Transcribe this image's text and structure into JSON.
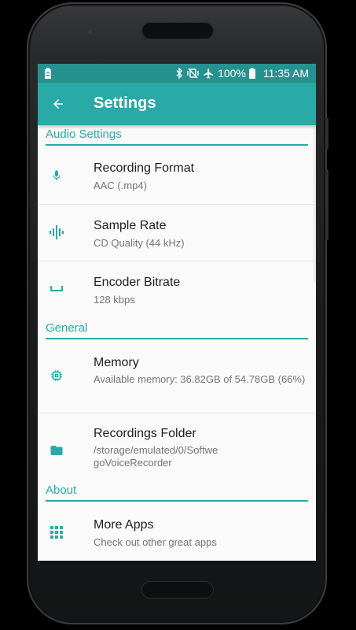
{
  "status_bar": {
    "battery_percent": "100%",
    "time": "11:35 AM",
    "icons": [
      "bluetooth-icon",
      "vibrate-off-icon",
      "airplane-icon",
      "battery-full-icon"
    ]
  },
  "app_bar": {
    "title": "Settings",
    "back_icon": "arrow-back-icon"
  },
  "colors": {
    "accent": "#2aaaa6",
    "status_bar": "#26928f",
    "title_text": "#212121",
    "summary_text": "#757575"
  },
  "sections": [
    {
      "header": "Audio Settings",
      "items": [
        {
          "icon": "microphone-icon",
          "title": "Recording Format",
          "summary": "AAC (.mp4)"
        },
        {
          "icon": "waveform-icon",
          "title": "Sample Rate",
          "summary": "CD Quality (44 kHz)"
        },
        {
          "icon": "space-bar-icon",
          "title": "Encoder Bitrate",
          "summary": "128 kbps"
        }
      ]
    },
    {
      "header": "General",
      "items": [
        {
          "icon": "memory-chip-icon",
          "title": "Memory",
          "summary": "Available memory: 36.82GB of 54.78GB (66%)"
        },
        {
          "icon": "folder-icon",
          "title": "Recordings Folder",
          "summary": "/storage/emulated/0/SoftwegoVoiceRecorder"
        }
      ]
    },
    {
      "header": "About",
      "items": [
        {
          "icon": "apps-grid-icon",
          "title": "More Apps",
          "summary": "Check out other great apps"
        }
      ]
    }
  ]
}
